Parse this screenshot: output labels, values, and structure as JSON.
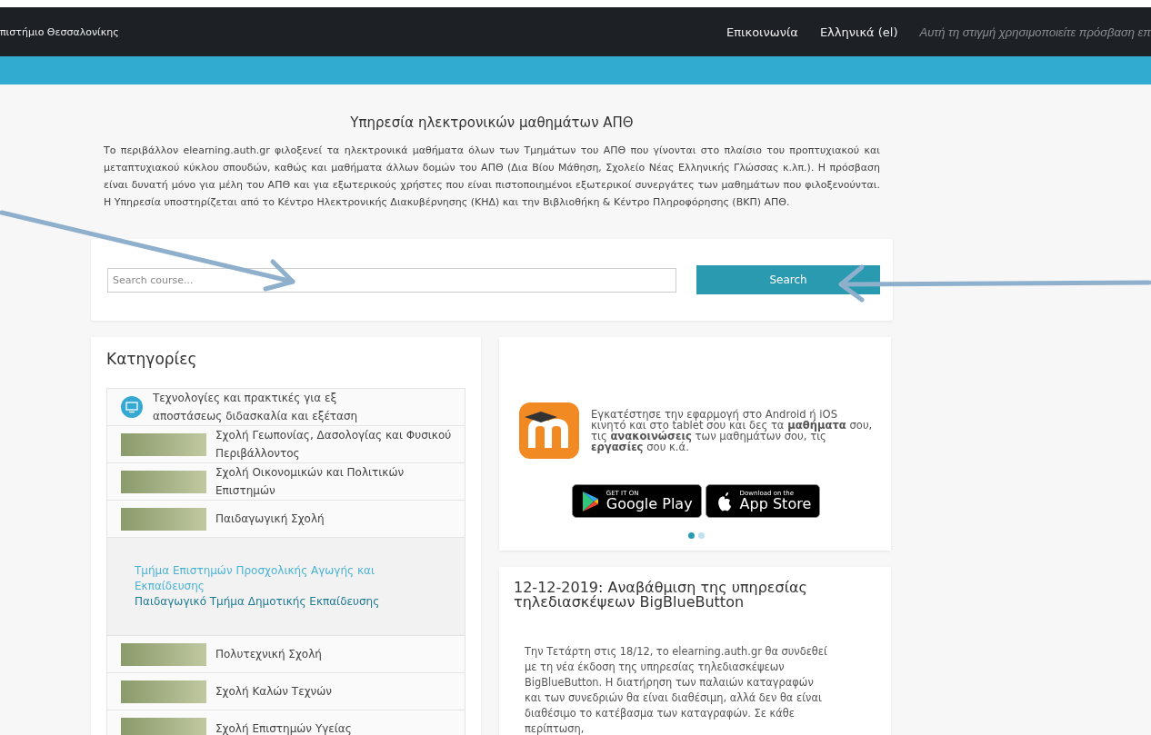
{
  "topbar": {
    "site_name": "πιστήμιο Θεσσαλονίκης",
    "links": [
      "Επικοινωνία",
      "Ελληνικά (el)"
    ],
    "guest_notice": "Αυτή τη στιγμή χρησιμοποιείτε πρόσβαση επ"
  },
  "intro": {
    "title": "Υπηρεσία ηλεκτρονικών μαθημάτων ΑΠΘ",
    "text": "Το περιβάλλον elearning.auth.gr φιλοξενεί τα ηλεκτρονικά μαθήματα όλων των Τμημάτων του ΑΠΘ που γίνονται στο πλαίσιο του προπτυχιακού και μεταπτυχιακού κύκλου σπουδών, καθώς και μαθήματα άλλων δομών του ΑΠΘ (Δια Βίου Μάθηση, Σχολείο Νέας Ελληνικής Γλώσσας κ.λπ.). Η πρόσβαση είναι δυνατή μόνο για μέλη του ΑΠΘ και για εξωτερικούς χρήστες που είναι πιστοποιημένοι εξωτερικοί συνεργάτες των μαθημάτων που φιλοξενούνται. Η Υπηρεσία υποστηρίζεται από το Κέντρο Ηλεκτρονικής Διακυβέρνησης (ΚΗΔ) και την Βιβλιοθήκη & Κέντρο Πληροφόρησης (ΒΚΠ) ΑΠΘ."
  },
  "search": {
    "placeholder": "Search course...",
    "button": "Search"
  },
  "categories": {
    "title": "Κατηγορίες",
    "items": [
      {
        "kind": "icon",
        "label": "Τεχνολογίες και πρακτικές για εξ αποστάσεως διδασκαλία και εξέταση"
      },
      {
        "kind": "photo",
        "label": "Σχολή Γεωπονίας, Δασολογίας και Φυσικού Περιβάλλοντος"
      },
      {
        "kind": "photo",
        "label": "Σχολή Οικονομικών και Πολιτικών Επιστημών"
      },
      {
        "kind": "photo",
        "label": "Παιδαγωγική Σχολή",
        "expanded": true,
        "children": [
          {
            "label": "Τμήμα Επιστημών Προσχολικής Αγωγής και Εκπαίδευσης",
            "color": "#4db3d4"
          },
          {
            "label": "Παιδαγωγικό Τμήμα Δημοτικής Εκπαίδευσης",
            "color": "#1f7a94"
          }
        ]
      },
      {
        "kind": "photo",
        "label": "Πολυτεχνική Σχολή"
      },
      {
        "kind": "photo",
        "label": "Σχολή Καλών Τεχνών"
      },
      {
        "kind": "photo",
        "label": "Σχολή Επιστημών Υγείας"
      }
    ]
  },
  "app_promo": {
    "text": "Εγκατέστησε την εφαρμογή στο Android ή iOS κινητό και στο tablet σου και δες τα **μαθήματα** σου, τις **ανακοινώσεις** των μαθημάτων σου, τις **εργασίες** σου κ.ά.",
    "badges": [
      {
        "kind": "google",
        "small": "GET IT ON",
        "big": "Google Play"
      },
      {
        "kind": "apple",
        "small": "Download on the",
        "big": "App Store"
      }
    ],
    "dots": [
      {
        "selected": true
      },
      {
        "selected": false
      }
    ]
  },
  "news": {
    "title": "12-12-2019: Αναβάθμιση της υπηρεσίας τηλεδιασκέψεων BigBlueButton",
    "text": "Την Τετάρτη στις 18/12, το elearning.auth.gr θα συνδεθεί με τη νέα έκδοση της υπηρεσίας τηλεδιασκέψεων BigBlueButton. Η διατήρηση των παλαιών καταγραφών και των συνεδριών θα είναι διαθέσιμη, αλλά δεν θα είναι διαθέσιμο το κατέβασμα των καταγραφών. Σε κάθε περίπτωση,"
  }
}
